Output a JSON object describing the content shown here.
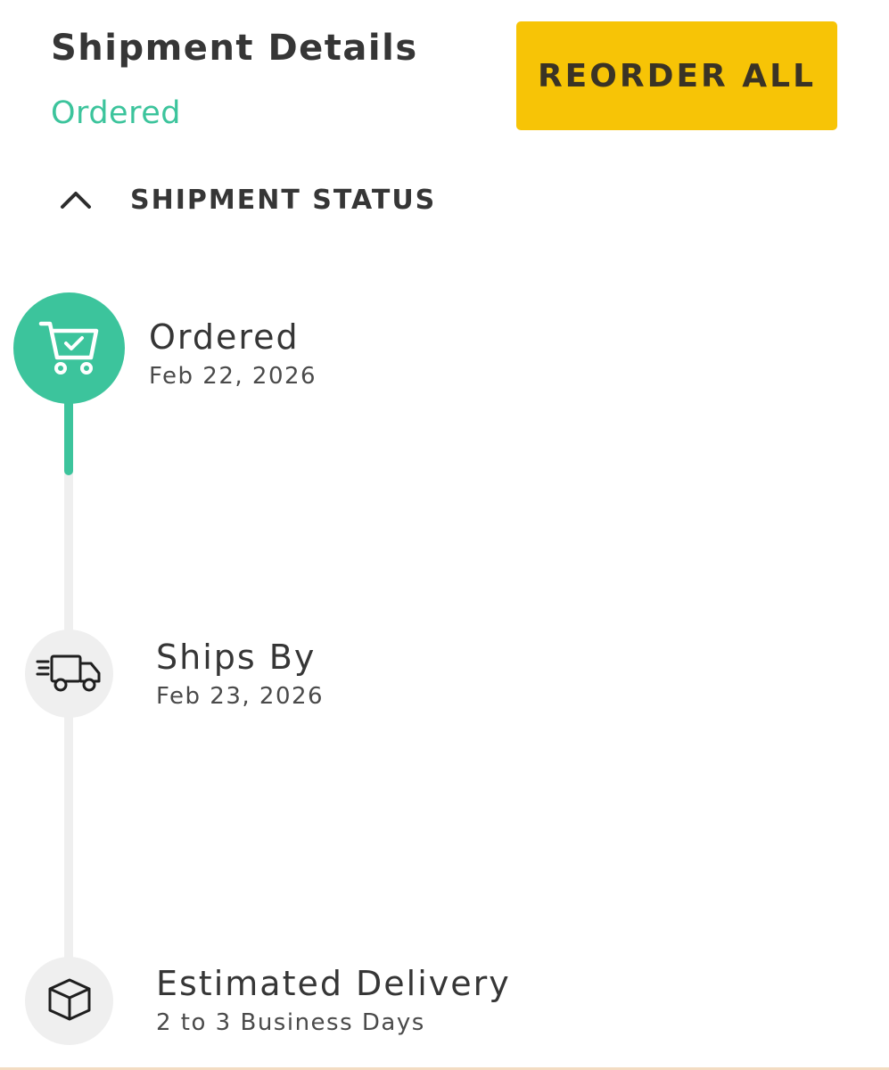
{
  "header": {
    "title": "Shipment Details",
    "status": "Ordered",
    "reorder_label": "REORDER ALL"
  },
  "colors": {
    "accent": "#3cc49c",
    "button": "#f7c406",
    "pending": "#efefef"
  },
  "shipment_status": {
    "section_label": "SHIPMENT STATUS",
    "expanded": true,
    "steps": [
      {
        "icon": "cart-check-icon",
        "title": "Ordered",
        "detail": "Feb 22, 2026",
        "state": "complete"
      },
      {
        "icon": "delivery-truck-icon",
        "title": "Ships By",
        "detail": "Feb 23, 2026",
        "state": "pending"
      },
      {
        "icon": "package-box-icon",
        "title": "Estimated Delivery",
        "detail": "2 to 3 Business Days",
        "state": "pending"
      }
    ]
  }
}
